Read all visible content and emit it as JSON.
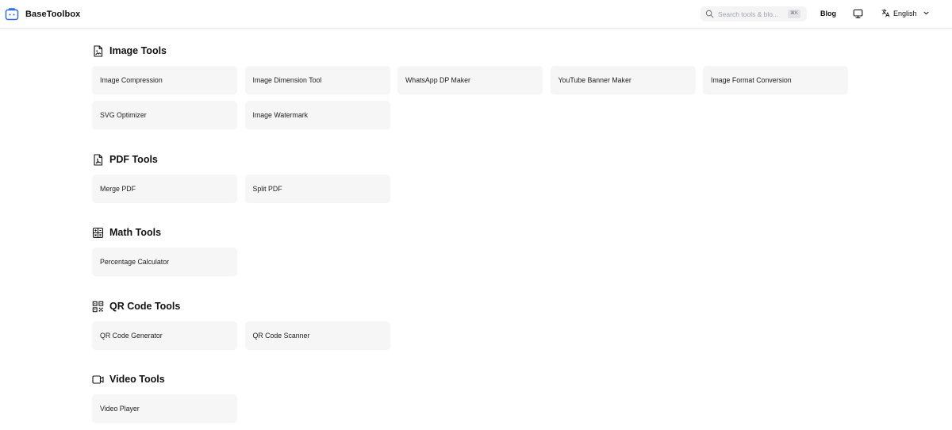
{
  "header": {
    "brand_name": "BaseToolbox",
    "search_placeholder": "Search tools & blo...",
    "search_shortcut": "⌘K",
    "blog_label": "Blog",
    "language_label": "English"
  },
  "sections": [
    {
      "title": "Image Tools",
      "icon": "image-file-icon",
      "tools": [
        "Image Compression",
        "Image Dimension Tool",
        "WhatsApp DP Maker",
        "YouTube Banner Maker",
        "Image Format Conversion",
        "SVG Optimizer",
        "Image Watermark"
      ]
    },
    {
      "title": "PDF Tools",
      "icon": "pdf-file-icon",
      "tools": [
        "Merge PDF",
        "Split PDF"
      ]
    },
    {
      "title": "Math Tools",
      "icon": "calculator-icon",
      "tools": [
        "Percentage Calculator"
      ]
    },
    {
      "title": "QR Code Tools",
      "icon": "qr-code-icon",
      "tools": [
        "QR Code Generator",
        "QR Code Scanner"
      ]
    },
    {
      "title": "Video Tools",
      "icon": "video-icon",
      "tools": [
        "Video Player"
      ]
    }
  ]
}
